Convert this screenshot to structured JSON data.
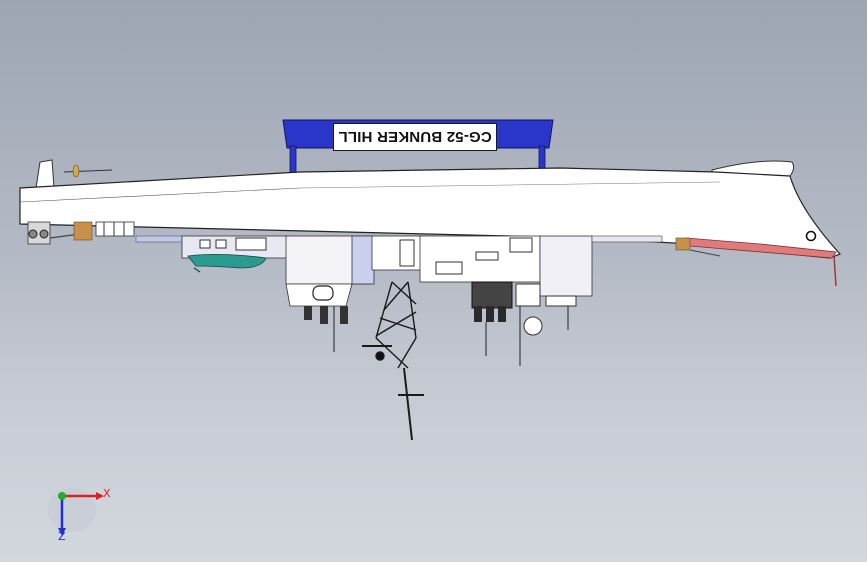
{
  "viewport": {
    "background_top": "#9da5b3",
    "background_bottom": "#d3d7de"
  },
  "model": {
    "hull_name_label": "CG-52 BUNKER HILL",
    "hull_color": "#ffffff",
    "banner_frame_color": "#2a35c9",
    "bow_underside_color": "#e07b7b",
    "boat_color": "#2b9a8f"
  },
  "triad": {
    "x_label": "X",
    "z_label": "Z",
    "x_color": "#e02020",
    "y_color": "#20b020",
    "z_color": "#2030d0"
  }
}
